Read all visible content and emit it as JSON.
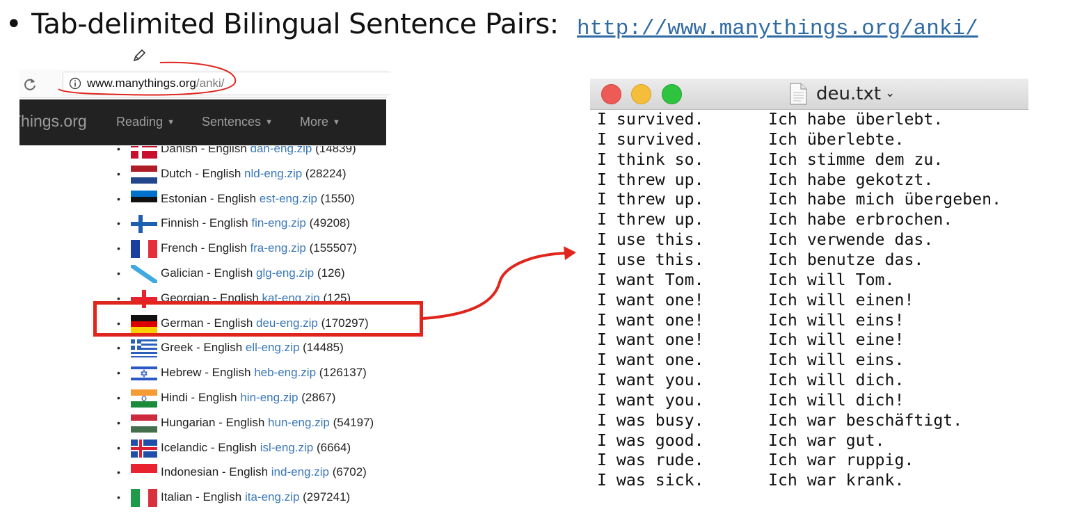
{
  "slide": {
    "bullet": "•",
    "title": "Tab-delimited Bilingual Sentence Pairs:",
    "link": "http://www.manythings.org/anki/"
  },
  "browser": {
    "address_domain": "www.manythings.org",
    "address_path": "/anki/",
    "brand": "Things.org",
    "nav": [
      {
        "label": "Reading"
      },
      {
        "label": "Sentences"
      },
      {
        "label": "More"
      }
    ],
    "caret": "▼"
  },
  "languages": [
    {
      "name": "Danish - English",
      "file": "dan-eng.zip",
      "count": "(14839)",
      "flag": "danish-flag"
    },
    {
      "name": "Dutch - English",
      "file": "nld-eng.zip",
      "count": "(28224)",
      "flag": "dutch-flag"
    },
    {
      "name": "Estonian - English",
      "file": "est-eng.zip",
      "count": "(1550)",
      "flag": "estonian-flag"
    },
    {
      "name": "Finnish - English",
      "file": "fin-eng.zip",
      "count": "(49208)",
      "flag": "finnish-flag"
    },
    {
      "name": "French - English",
      "file": "fra-eng.zip",
      "count": "(155507)",
      "flag": "french-flag"
    },
    {
      "name": "Galician - English",
      "file": "glg-eng.zip",
      "count": "(126)",
      "flag": "galician-flag"
    },
    {
      "name": "Georgian - English",
      "file": "kat-eng.zip",
      "count": "(125)",
      "flag": "georgian-flag"
    },
    {
      "name": "German - English",
      "file": "deu-eng.zip",
      "count": "(170297)",
      "flag": "german-flag"
    },
    {
      "name": "Greek - English",
      "file": "ell-eng.zip",
      "count": "(14485)",
      "flag": "greek-flag"
    },
    {
      "name": "Hebrew - English",
      "file": "heb-eng.zip",
      "count": "(126137)",
      "flag": "hebrew-flag"
    },
    {
      "name": "Hindi - English",
      "file": "hin-eng.zip",
      "count": "(2867)",
      "flag": "hindi-flag"
    },
    {
      "name": "Hungarian - English",
      "file": "hun-eng.zip",
      "count": "(54197)",
      "flag": "hungarian-flag"
    },
    {
      "name": "Icelandic - English",
      "file": "isl-eng.zip",
      "count": "(6664)",
      "flag": "icelandic-flag"
    },
    {
      "name": "Indonesian - English",
      "file": "ind-eng.zip",
      "count": "(6702)",
      "flag": "indonesian-flag"
    },
    {
      "name": "Italian - English",
      "file": "ita-eng.zip",
      "count": "(297241)",
      "flag": "italian-flag"
    }
  ],
  "window": {
    "title": "deu.txt",
    "chevron": "⌄"
  },
  "sentences": [
    {
      "en": "I survived.",
      "de": "Ich habe überlebt."
    },
    {
      "en": "I survived.",
      "de": "Ich überlebte."
    },
    {
      "en": "I think so.",
      "de": "Ich stimme dem zu."
    },
    {
      "en": "I threw up.",
      "de": "Ich habe gekotzt."
    },
    {
      "en": "I threw up.",
      "de": "Ich habe mich übergeben."
    },
    {
      "en": "I threw up.",
      "de": "Ich habe erbrochen."
    },
    {
      "en": "I use this.",
      "de": "Ich verwende das."
    },
    {
      "en": "I use this.",
      "de": "Ich benutze das."
    },
    {
      "en": "I want Tom.",
      "de": "Ich will Tom."
    },
    {
      "en": "I want one!",
      "de": "Ich will einen!"
    },
    {
      "en": "I want one!",
      "de": "Ich will eins!"
    },
    {
      "en": "I want one!",
      "de": "Ich will eine!"
    },
    {
      "en": "I want one.",
      "de": "Ich will eins."
    },
    {
      "en": "I want you.",
      "de": "Ich will dich."
    },
    {
      "en": "I want you.",
      "de": "Ich will dich!"
    },
    {
      "en": "I was busy.",
      "de": "Ich war beschäftigt."
    },
    {
      "en": "I was good.",
      "de": "Ich war gut."
    },
    {
      "en": "I was rude.",
      "de": "Ich war ruppig."
    },
    {
      "en": "I was sick.",
      "de": "Ich war krank."
    }
  ],
  "colors": {
    "highlight": "#e0251c",
    "link": "#3a77b7",
    "nav_bg": "#222222"
  }
}
